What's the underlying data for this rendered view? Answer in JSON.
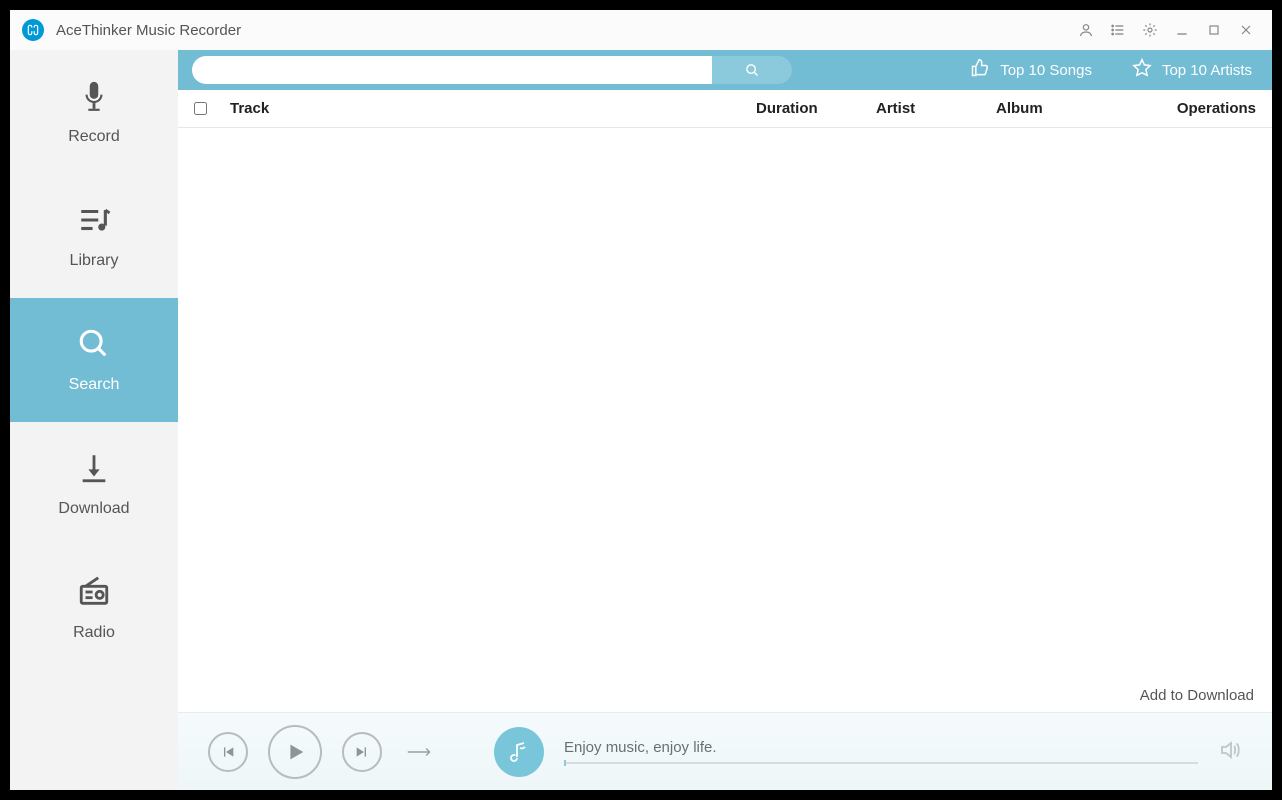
{
  "titlebar": {
    "title": "AceThinker Music Recorder"
  },
  "sidebar": {
    "items": [
      {
        "label": "Record"
      },
      {
        "label": "Library"
      },
      {
        "label": "Search"
      },
      {
        "label": "Download"
      },
      {
        "label": "Radio"
      }
    ]
  },
  "searchbar": {
    "placeholder": "",
    "top_songs": "Top 10 Songs",
    "top_artists": "Top 10 Artists"
  },
  "columns": {
    "track": "Track",
    "duration": "Duration",
    "artist": "Artist",
    "album": "Album",
    "operations": "Operations"
  },
  "footer": {
    "add_to_download": "Add to Download"
  },
  "player": {
    "tagline": "Enjoy music, enjoy life."
  }
}
